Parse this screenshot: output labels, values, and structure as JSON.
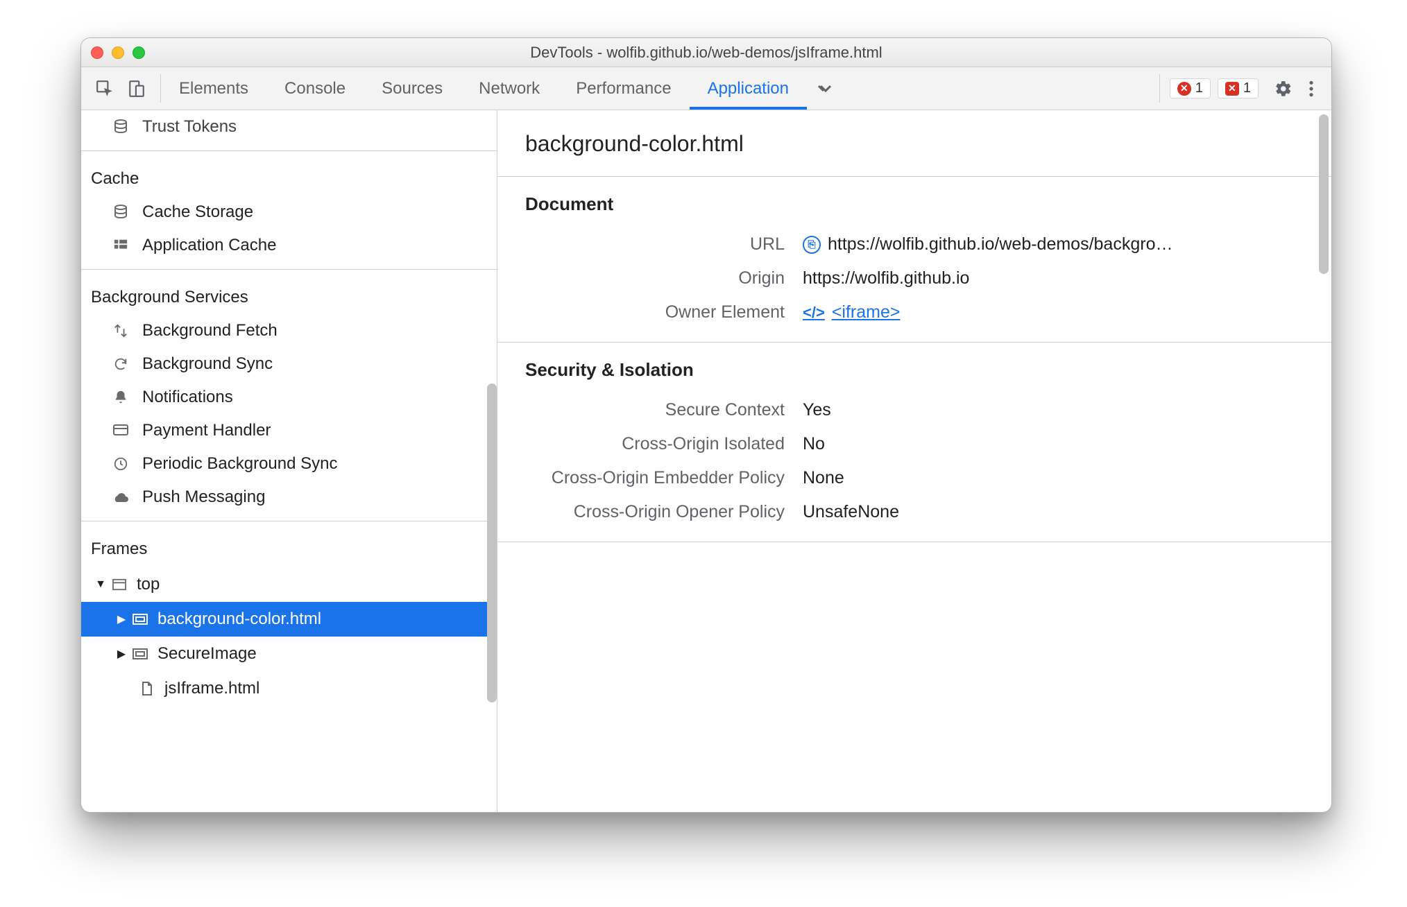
{
  "window": {
    "title": "DevTools - wolfib.github.io/web-demos/jsIframe.html"
  },
  "tabs": {
    "items": [
      "Elements",
      "Console",
      "Sources",
      "Network",
      "Performance",
      "Application"
    ],
    "selected": "Application"
  },
  "errors": {
    "count1": "1",
    "count2": "1"
  },
  "sidebar": {
    "trustTokens": "Trust Tokens",
    "cacheHeader": "Cache",
    "cacheItems": [
      "Cache Storage",
      "Application Cache"
    ],
    "bgHeader": "Background Services",
    "bgItems": [
      "Background Fetch",
      "Background Sync",
      "Notifications",
      "Payment Handler",
      "Periodic Background Sync",
      "Push Messaging"
    ],
    "framesHeader": "Frames",
    "tree": {
      "top": "top",
      "bgcolor": "background-color.html",
      "secureImage": "SecureImage",
      "jsIframe": "jsIframe.html"
    }
  },
  "details": {
    "title": "background-color.html",
    "docHeader": "Document",
    "doc": {
      "urlLabel": "URL",
      "url": "https://wolfib.github.io/web-demos/backgro…",
      "originLabel": "Origin",
      "origin": "https://wolfib.github.io",
      "ownerLabel": "Owner Element",
      "owner": " <iframe>"
    },
    "secHeader": "Security & Isolation",
    "sec": {
      "secureCtxLabel": "Secure Context",
      "secureCtx": "Yes",
      "coiLabel": "Cross-Origin Isolated",
      "coi": "No",
      "coepLabel": "Cross-Origin Embedder Policy",
      "coep": "None",
      "coopLabel": "Cross-Origin Opener Policy",
      "coop": "UnsafeNone"
    }
  }
}
